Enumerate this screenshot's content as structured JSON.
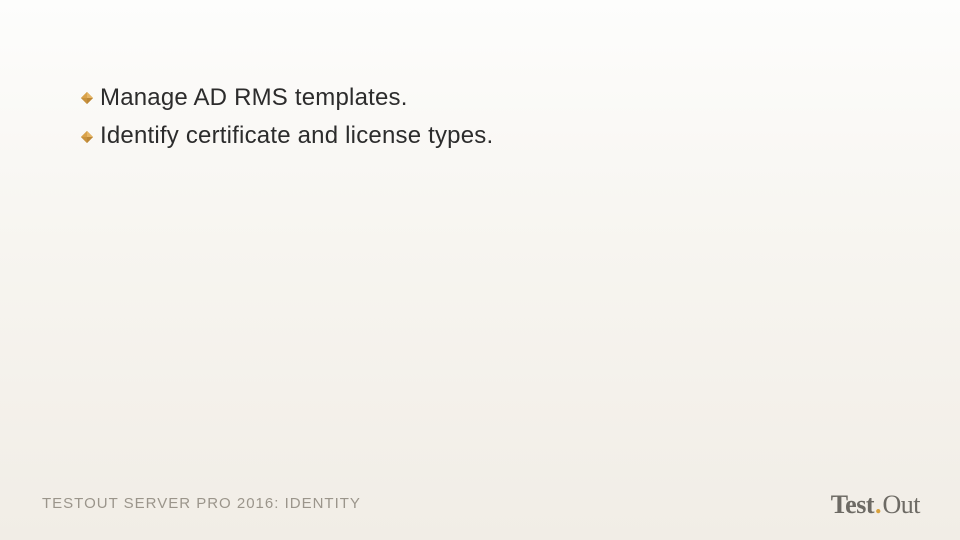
{
  "bullets": {
    "items": [
      {
        "text": "Manage AD RMS templates."
      },
      {
        "text": "Identify certificate and license types."
      }
    ]
  },
  "footer": {
    "course": "TESTOUT SERVER PRO 2016: IDENTITY"
  },
  "logo": {
    "part1": "Test",
    "dot": ".",
    "part2": "Out"
  },
  "colors": {
    "bullet_fill": "#e0a94e",
    "bullet_shadow": "#b7893a"
  }
}
